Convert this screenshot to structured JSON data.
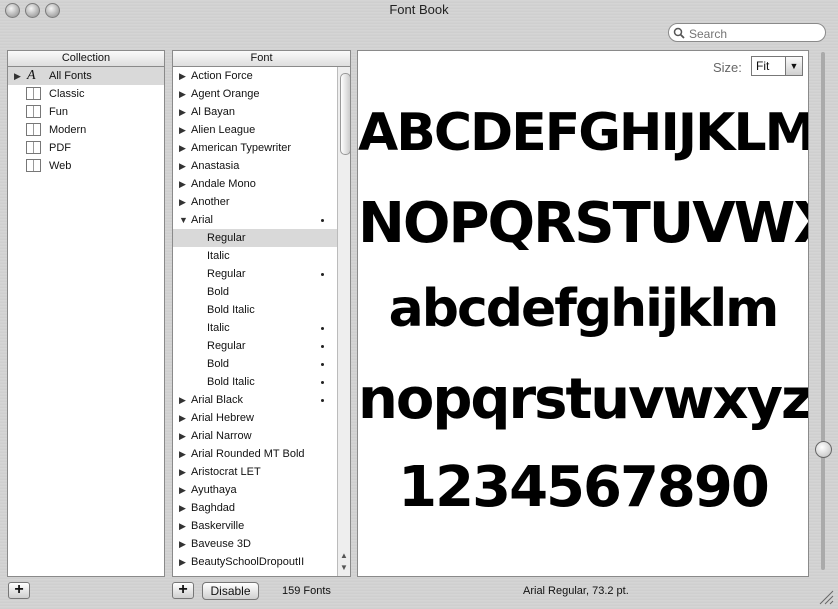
{
  "window": {
    "title": "Font Book"
  },
  "search": {
    "placeholder": "Search",
    "value": ""
  },
  "collection_pane": {
    "header": "Collection",
    "items": [
      {
        "label": "All Fonts",
        "icon": "all-fonts-icon",
        "selected": true
      },
      {
        "label": "Classic",
        "icon": "collection-book-icon"
      },
      {
        "label": "Fun",
        "icon": "collection-book-icon"
      },
      {
        "label": "Modern",
        "icon": "collection-book-icon"
      },
      {
        "label": "PDF",
        "icon": "collection-book-icon"
      },
      {
        "label": "Web",
        "icon": "collection-book-icon"
      }
    ]
  },
  "font_pane": {
    "header": "Font",
    "items": [
      {
        "label": "Action Force",
        "type": "family"
      },
      {
        "label": "Agent Orange",
        "type": "family"
      },
      {
        "label": "Al Bayan",
        "type": "family"
      },
      {
        "label": "Alien League",
        "type": "family"
      },
      {
        "label": "American Typewriter",
        "type": "family"
      },
      {
        "label": "Anastasia",
        "type": "family"
      },
      {
        "label": "Andale Mono",
        "type": "family"
      },
      {
        "label": "Another",
        "type": "family"
      },
      {
        "label": "Arial",
        "type": "family-open",
        "dot": true
      },
      {
        "label": "Regular",
        "type": "face",
        "selected": true
      },
      {
        "label": "Italic",
        "type": "face"
      },
      {
        "label": "Regular",
        "type": "face",
        "dot": true
      },
      {
        "label": "Bold",
        "type": "face"
      },
      {
        "label": "Bold Italic",
        "type": "face"
      },
      {
        "label": "Italic",
        "type": "face",
        "dot": true
      },
      {
        "label": "Regular",
        "type": "face",
        "dot": true
      },
      {
        "label": "Bold",
        "type": "face",
        "dot": true
      },
      {
        "label": "Bold Italic",
        "type": "face",
        "dot": true
      },
      {
        "label": "Arial Black",
        "type": "family",
        "dot": true
      },
      {
        "label": "Arial Hebrew",
        "type": "family"
      },
      {
        "label": "Arial Narrow",
        "type": "family"
      },
      {
        "label": "Arial Rounded MT Bold",
        "type": "family"
      },
      {
        "label": "Aristocrat LET",
        "type": "family"
      },
      {
        "label": "Ayuthaya",
        "type": "family"
      },
      {
        "label": "Baghdad",
        "type": "family"
      },
      {
        "label": "Baskerville",
        "type": "family"
      },
      {
        "label": "Baveuse 3D",
        "type": "family"
      },
      {
        "label": "BeautySchoolDropoutII",
        "type": "family"
      }
    ]
  },
  "preview": {
    "size_label": "Size:",
    "size_value": "Fit",
    "lines": [
      "ABCDEFGHIJKLM",
      "NOPQRSTUVWXYZ",
      "abcdefghijklm",
      "nopqrstuvwxyz",
      "1234567890"
    ]
  },
  "footer": {
    "add_collection": "+",
    "add_font": "+",
    "disable_button": "Disable",
    "font_count": "159 Fonts",
    "status": "Arial Regular, 73.2 pt."
  }
}
